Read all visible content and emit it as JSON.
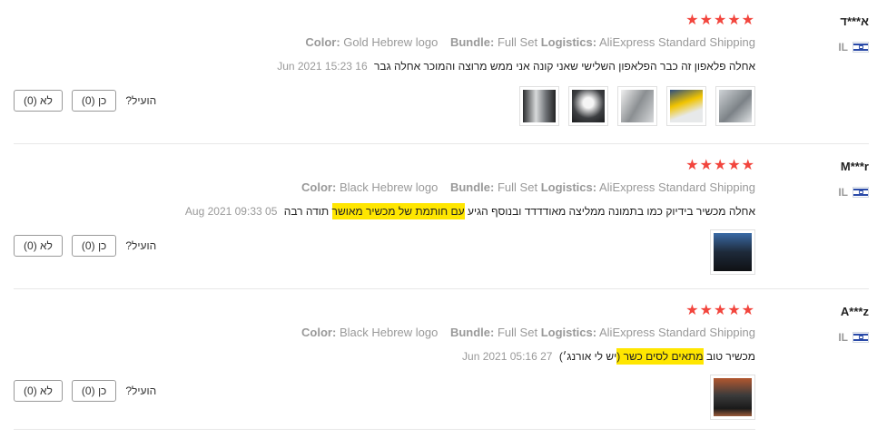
{
  "reviews": [
    {
      "user": "א***ד",
      "country": "IL",
      "stars": "★★★★★",
      "color_label": "Color:",
      "color_value": "Gold Hebrew logo",
      "bundle_label": "Bundle:",
      "bundle_value": "Full Set",
      "logistics_label": "Logistics:",
      "logistics_value": "AliExpress Standard Shipping",
      "text": "אחלה פלאפון זה כבר הפלאפון השלישי שאני קונה אני ממש מרוצה והמוכר אחלה גבר",
      "date": "16 Jun 2021 15:23",
      "helpful": "הועיל?",
      "yes": "כן (0)",
      "no": "לא (0)"
    },
    {
      "user": "M***r",
      "country": "IL",
      "stars": "★★★★★",
      "color_label": "Color:",
      "color_value": "Black Hebrew logo",
      "bundle_label": "Bundle:",
      "bundle_value": "Full Set",
      "logistics_label": "Logistics:",
      "logistics_value": "AliExpress Standard Shipping",
      "text_a": "אחלה מכשיר בידיוק כמו בתמונה ממליצה מאודדדד ובנוסף הגיע",
      "text_hl": "עם חותמת של מכשיר מאושר",
      "text_b": "תודה רבה",
      "date": "05 Aug 2021 09:33",
      "helpful": "הועיל?",
      "yes": "כן (0)",
      "no": "לא (0)"
    },
    {
      "user": "A***z",
      "country": "IL",
      "stars": "★★★★★",
      "color_label": "Color:",
      "color_value": "Black Hebrew logo",
      "bundle_label": "Bundle:",
      "bundle_value": "Full Set",
      "logistics_label": "Logistics:",
      "logistics_value": "AliExpress Standard Shipping",
      "text_a": "מכשיר טוב",
      "text_hl": "מתאים לסים כשר (",
      "text_b": "יש לי אורנג׳)",
      "date": "27 Jun 2021 05:16",
      "helpful": "הועיל?",
      "yes": "כן (0)",
      "no": "לא (0)"
    }
  ]
}
